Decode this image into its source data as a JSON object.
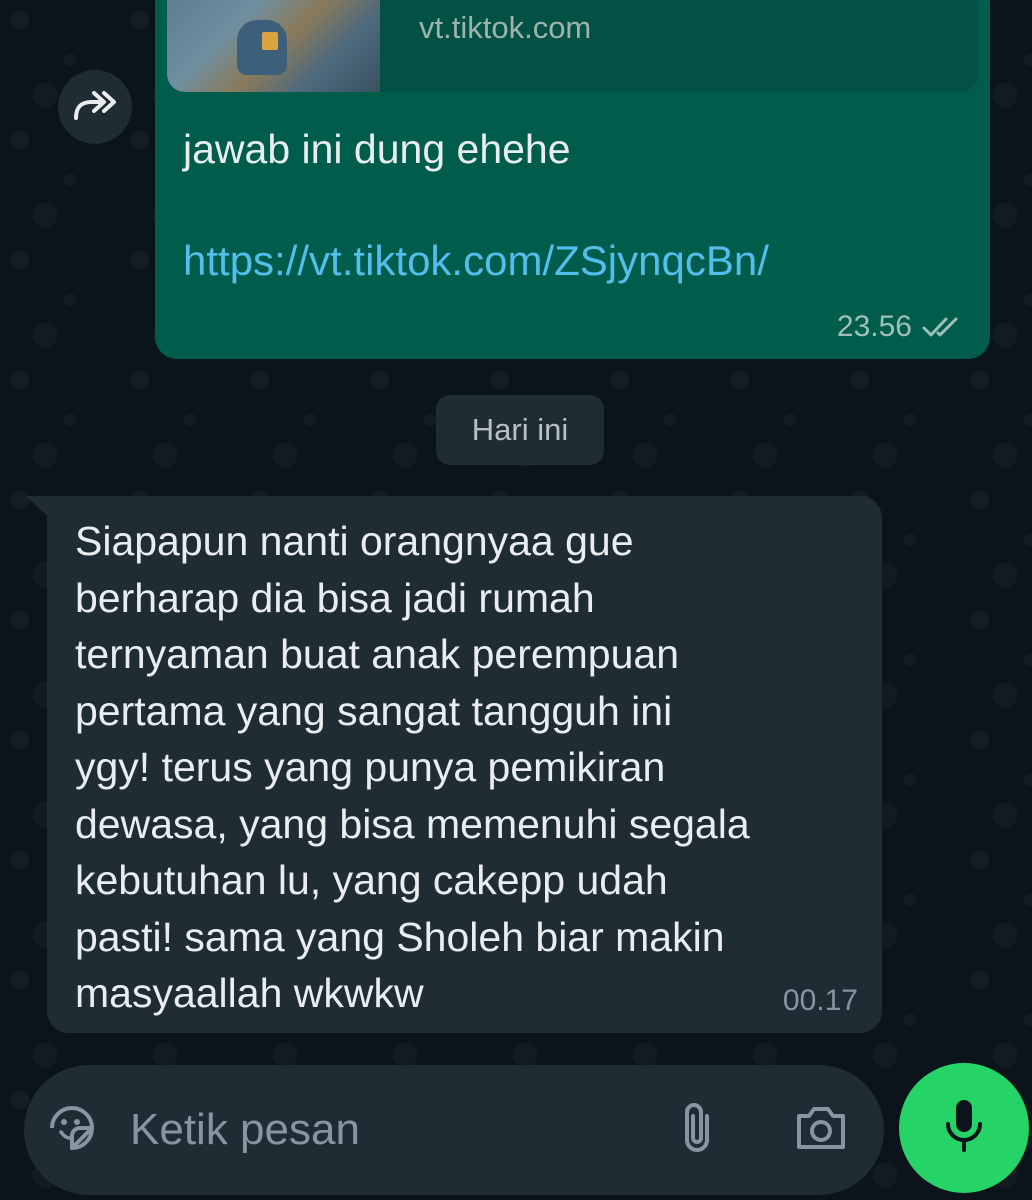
{
  "colors": {
    "chat_background": "#0b141a",
    "outgoing_bubble": "#005c4b",
    "incoming_bubble": "#1f2c33",
    "link": "#53bdeb",
    "mic_button": "#25d366",
    "meta_text": "#8696a0"
  },
  "outgoing_message": {
    "preview_domain": "vt.tiktok.com",
    "text": "jawab ini dung ehehe",
    "link": "https://vt.tiktok.com/ZSjynqcBn/",
    "time": "23.56",
    "status_icon": "double-check-icon"
  },
  "forward_button": {
    "icon": "forward-icon"
  },
  "date_divider": {
    "label": "Hari ini"
  },
  "incoming_message": {
    "text": "Siapapun nanti orangnyaa gue\nberharap dia bisa jadi rumah\nternyaman buat anak perempuan\npertama yang sangat tangguh ini\nygy! terus yang punya pemikiran\ndewasa, yang bisa memenuhi segala\nkebutuhan lu, yang cakepp udah\npasti! sama yang Sholeh   biar makin\nmasyaallah wkwkw",
    "time": "00.17"
  },
  "composer": {
    "placeholder": "Ketik pesan",
    "value": "",
    "emoji_icon": "sticker-emoji-icon",
    "attach_icon": "paperclip-icon",
    "camera_icon": "camera-icon",
    "mic_icon": "microphone-icon"
  }
}
